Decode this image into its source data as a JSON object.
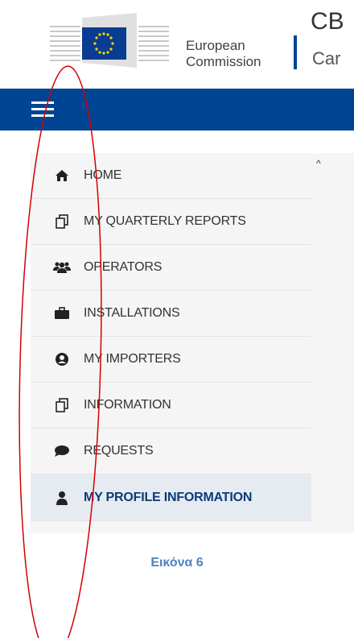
{
  "header": {
    "logo_line1": "European",
    "logo_line2": "Commission",
    "app_abbrev": "CB",
    "app_sub": "Car"
  },
  "menu": {
    "items": [
      {
        "label": "HOME",
        "icon": "home-icon"
      },
      {
        "label": "MY QUARTERLY REPORTS",
        "icon": "copy-icon"
      },
      {
        "label": "OPERATORS",
        "icon": "users-icon"
      },
      {
        "label": "INSTALLATIONS",
        "icon": "briefcase-icon"
      },
      {
        "label": "MY IMPORTERS",
        "icon": "user-circle-icon"
      },
      {
        "label": "INFORMATION",
        "icon": "copy-icon"
      },
      {
        "label": "REQUESTS",
        "icon": "comment-icon"
      },
      {
        "label": "MY PROFILE INFORMATION",
        "icon": "user-icon",
        "active": true
      }
    ]
  },
  "caption": "Εικόνα 6",
  "colors": {
    "brand_blue": "#004494",
    "active_bg": "#e6ebf2",
    "annotation_red": "#d40000",
    "caption_blue": "#4f81bd"
  }
}
